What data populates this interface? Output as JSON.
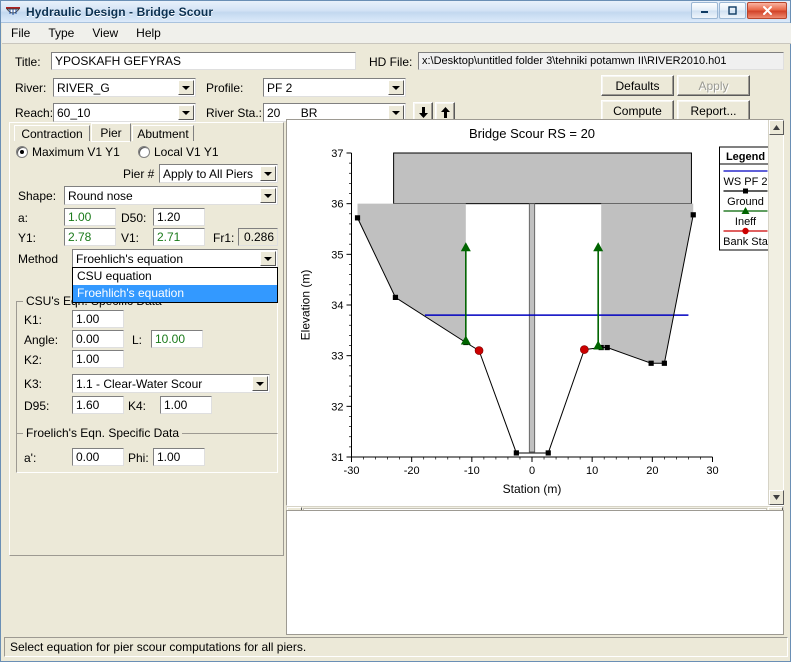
{
  "window": {
    "title": "Hydraulic Design - Bridge Scour",
    "icon": "hecras-icon",
    "minimize": "minimize-icon",
    "maximize": "maximize-icon",
    "close": "close-icon"
  },
  "menu": [
    {
      "label": "File"
    },
    {
      "label": "Type"
    },
    {
      "label": "View"
    },
    {
      "label": "Help"
    }
  ],
  "header": {
    "title_label": "Title:",
    "title_value": "YPOSKAFH GEFYRAS",
    "hdfile_label": "HD File:",
    "hdfile_value": "x:\\Desktop\\untitled folder 3\\tehniki potamwn II\\RIVER2010.h01",
    "river_label": "River:",
    "river_value": "RIVER_G",
    "reach_label": "Reach:",
    "reach_value": "60_10",
    "profile_label": "Profile:",
    "profile_value": "PF 2",
    "riversta_label": "River Sta.:",
    "riversta_value": "20",
    "riversta_suffix": "BR",
    "down_arrow": "down-arrow-icon",
    "up_arrow": "up-arrow-icon",
    "buttons": {
      "defaults": "Defaults",
      "apply": "Apply",
      "compute": "Compute",
      "report": "Report..."
    }
  },
  "tabs": [
    {
      "label": "Contraction",
      "active": false
    },
    {
      "label": "Pier",
      "active": true
    },
    {
      "label": "Abutment",
      "active": false
    }
  ],
  "pier": {
    "radio_max": "Maximum V1 Y1",
    "radio_local": "Local V1 Y1",
    "radio_selected": "Maximum V1 Y1",
    "pier_num_label": "Pier #",
    "pier_num_value": "Apply to All Piers",
    "shape_label": "Shape:",
    "shape_value": "Round nose",
    "a_label": "a:",
    "a_value": "1.00",
    "d50_label": "D50:",
    "d50_value": "1.20",
    "y1_label": "Y1:",
    "y1_value": "2.78",
    "v1_label": "V1:",
    "v1_value": "2.71",
    "fr1_label": "Fr1:",
    "fr1_value": "0.286",
    "method_label": "Method",
    "method_value": "Froehlich's equation",
    "method_options": [
      {
        "label": "CSU equation",
        "selected": false
      },
      {
        "label": "Froehlich's equation",
        "selected": true
      }
    ]
  },
  "csu": {
    "group_title": "CSU's Eqn. Specific Data",
    "k1_label": "K1:",
    "k1_value": "1.00",
    "angle_label": "Angle:",
    "angle_value": "0.00",
    "l_label": "L:",
    "l_value": "10.00",
    "k2_label": "K2:",
    "k2_value": "1.00",
    "k3_label": "K3:",
    "k3_value": "1.1 - Clear-Water Scour",
    "d95_label": "D95:",
    "d95_value": "1.60",
    "k4_label": "K4:",
    "k4_value": "1.00"
  },
  "froehlich": {
    "group_title": "Froelich's Eqn. Specific Data",
    "aprime_label": "a':",
    "aprime_value": "0.00",
    "phi_label": "Phi:",
    "phi_value": "1.00"
  },
  "status": {
    "message": "Select equation for pier scour computations for all piers."
  },
  "colors": {
    "ws_line": "#0000c0",
    "ground_line": "#000000",
    "ineff_marker": "#006400",
    "bank_marker": "#cc0000",
    "deck_fill": "#c0c0c0",
    "face_gray": "#ece9d8",
    "highlight": "#3399ff"
  },
  "chart_data": {
    "type": "line",
    "title": "Bridge Scour RS = 20",
    "xlabel": "Station (m)",
    "ylabel": "Elevation (m)",
    "xlim": [
      -30,
      30
    ],
    "ylim": [
      31,
      37
    ],
    "xticks": [
      -30,
      -20,
      -10,
      0,
      10,
      20,
      30
    ],
    "yticks": [
      31,
      32,
      33,
      34,
      35,
      36,
      37
    ],
    "grid": false,
    "legend_title": "Legend",
    "legend": [
      {
        "label": "WS PF 2",
        "color": "#0000c0",
        "marker": "line"
      },
      {
        "label": "Ground",
        "color": "#000000",
        "marker": "square"
      },
      {
        "label": "Ineff",
        "color": "#006400",
        "marker": "triangle"
      },
      {
        "label": "Bank Sta",
        "color": "#cc0000",
        "marker": "circle"
      }
    ],
    "series": [
      {
        "name": "Ground",
        "color": "#000000",
        "marker": "square",
        "points": [
          [
            -29.0,
            35.72
          ],
          [
            -22.7,
            34.15
          ],
          [
            -11.0,
            33.26
          ],
          [
            -8.8,
            33.1
          ],
          [
            -2.6,
            31.08
          ],
          [
            2.7,
            31.08
          ],
          [
            8.7,
            33.12
          ],
          [
            11.5,
            33.16
          ],
          [
            12.5,
            33.16
          ],
          [
            19.8,
            32.85
          ],
          [
            22.0,
            32.85
          ],
          [
            26.8,
            35.78
          ]
        ]
      },
      {
        "name": "WS PF 2",
        "color": "#0000c0",
        "marker": "line",
        "points": [
          [
            -17.8,
            33.8
          ],
          [
            26.0,
            33.8
          ]
        ]
      }
    ],
    "bank_stations": [
      {
        "station": -8.8,
        "elevation": 33.1
      },
      {
        "station": 8.7,
        "elevation": 33.12
      }
    ],
    "ineff_flow": [
      {
        "station": -11.0,
        "y_bottom": 33.26,
        "y_top": 35.1
      },
      {
        "station": 11.0,
        "y_bottom": 33.16,
        "y_top": 35.1
      }
    ],
    "bridge_deck": {
      "x_left": -23.0,
      "x_right": 26.5,
      "y_top": 37.0,
      "y_bottom": 36.0,
      "fill": "#c0c0c0"
    },
    "piers": [
      {
        "x_center": 0.0,
        "width": 0.9,
        "y_top": 36.0,
        "y_bottom": 31.1
      }
    ],
    "abutment_fills": [
      {
        "name": "left-abutment",
        "x_from": -29.0,
        "x_to": -11.0
      },
      {
        "name": "right-abutment",
        "x_from": 11.5,
        "x_to": 26.8
      }
    ]
  }
}
